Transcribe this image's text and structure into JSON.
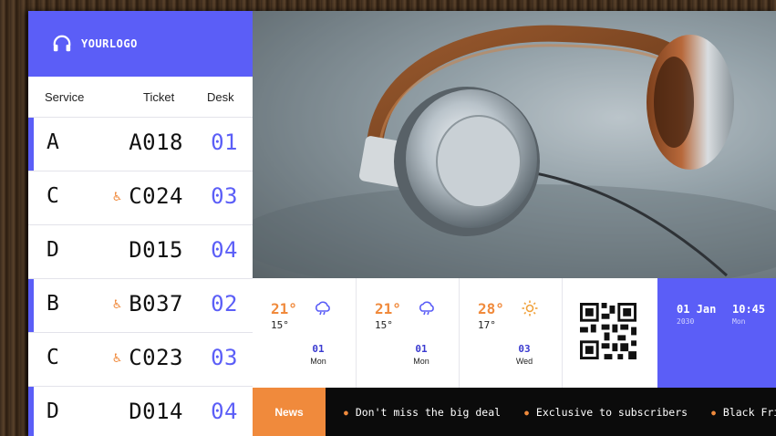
{
  "logo": {
    "text": "YOURLOGO",
    "icon": "headphones-icon"
  },
  "queue": {
    "headers": {
      "service": "Service",
      "ticket": "Ticket",
      "desk": "Desk"
    },
    "rows": [
      {
        "service": "A",
        "ticket": "A018",
        "desk": "01",
        "accessible": false,
        "active": true
      },
      {
        "service": "C",
        "ticket": "C024",
        "desk": "03",
        "accessible": true,
        "active": false
      },
      {
        "service": "D",
        "ticket": "D015",
        "desk": "04",
        "accessible": false,
        "active": false
      },
      {
        "service": "B",
        "ticket": "B037",
        "desk": "02",
        "accessible": true,
        "active": true
      },
      {
        "service": "C",
        "ticket": "C023",
        "desk": "03",
        "accessible": true,
        "active": false
      },
      {
        "service": "D",
        "ticket": "D014",
        "desk": "04",
        "accessible": false,
        "active": true
      }
    ],
    "accessible_icon": "wheelchair-icon"
  },
  "weather": [
    {
      "high": "21°",
      "low": "15°",
      "icon": "rain-cloud-icon",
      "day": "01",
      "dow": "Mon"
    },
    {
      "high": "21°",
      "low": "15°",
      "icon": "rain-cloud-icon",
      "day": "01",
      "dow": "Mon"
    },
    {
      "high": "28°",
      "low": "17°",
      "icon": "sun-icon",
      "day": "03",
      "dow": "Wed"
    }
  ],
  "qr": {
    "icon": "qr-code-icon"
  },
  "clock": {
    "date": "01 Jan",
    "year": "2030",
    "time": "10:45",
    "dow": "Mon"
  },
  "ticker": {
    "label": "News",
    "items": [
      "Don't miss the big deal",
      "Exclusive to subscribers",
      "Black Friday"
    ]
  },
  "colors": {
    "accent": "#5b5ef7",
    "orange": "#f08a3c",
    "ticker_bg": "#0b0b0b"
  }
}
